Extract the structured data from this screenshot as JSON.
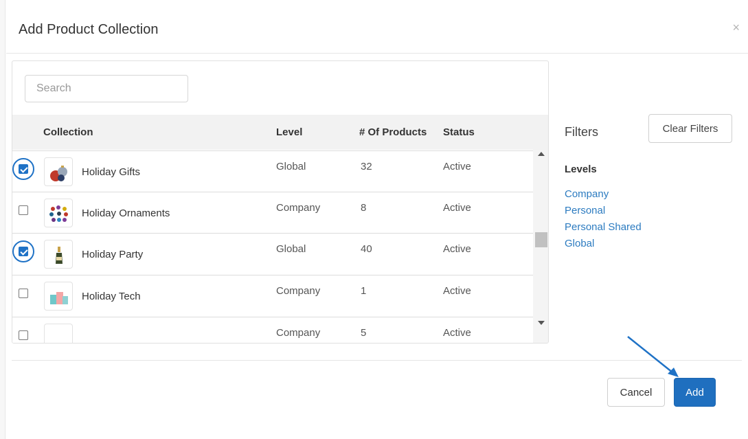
{
  "modal": {
    "title": "Add Product Collection",
    "close_glyph": "×"
  },
  "search": {
    "placeholder": "Search"
  },
  "table": {
    "headers": {
      "collection": "Collection",
      "level": "Level",
      "products": "# Of Products",
      "status": "Status"
    },
    "rows": [
      {
        "name": "Holiday Gifts",
        "level": "Global",
        "count": "32",
        "status": "Active",
        "checked": true,
        "highlighted": true,
        "thumb_icon": "gift-ornaments-icon"
      },
      {
        "name": "Holiday Ornaments",
        "level": "Company",
        "count": "8",
        "status": "Active",
        "checked": false,
        "highlighted": false,
        "thumb_icon": "ornaments-icon"
      },
      {
        "name": "Holiday Party",
        "level": "Global",
        "count": "40",
        "status": "Active",
        "checked": true,
        "highlighted": true,
        "thumb_icon": "champagne-bottle-icon"
      },
      {
        "name": "Holiday Tech",
        "level": "Company",
        "count": "1",
        "status": "Active",
        "checked": false,
        "highlighted": false,
        "thumb_icon": "tech-products-icon"
      },
      {
        "name": "",
        "level": "Company",
        "count": "5",
        "status": "Active",
        "checked": false,
        "highlighted": false,
        "thumb_icon": "product-thumbnail-icon"
      }
    ]
  },
  "filters": {
    "title": "Filters",
    "clear_label": "Clear Filters",
    "levels_title": "Levels",
    "levels": [
      "Company",
      "Personal",
      "Personal Shared",
      "Global"
    ]
  },
  "footer": {
    "cancel_label": "Cancel",
    "add_label": "Add"
  },
  "colors": {
    "accent": "#1f6fbf",
    "link": "#2c7bc0",
    "annotation": "#1f72c6"
  }
}
